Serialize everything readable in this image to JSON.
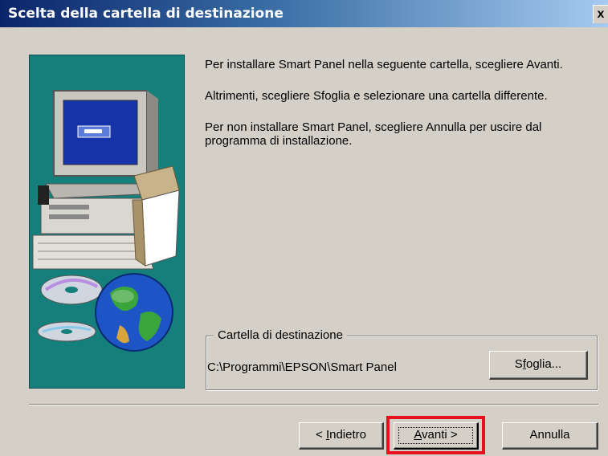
{
  "window": {
    "title": "Scelta della cartella di destinazione",
    "close_label": "x"
  },
  "instructions": {
    "para1": "Per installare Smart Panel nella seguente cartella, scegliere Avanti.",
    "para2": "Altrimenti, scegliere Sfoglia e selezionare una cartella differente.",
    "para3": "Per non installare Smart Panel, scegliere Annulla per uscire dal programma di installazione."
  },
  "destination": {
    "legend": "Cartella di destinazione",
    "path": "C:\\Programmi\\EPSON\\Smart Panel",
    "browse_pre": "S",
    "browse_accel": "f",
    "browse_post": "oglia..."
  },
  "footer": {
    "back_pre": "< ",
    "back_accel": "I",
    "back_post": "ndietro",
    "next_accel": "A",
    "next_post": "vanti >",
    "cancel_label": "Annulla"
  },
  "icons": {
    "illustration": "computer-globe-cd-illustration",
    "close": "close-icon"
  },
  "colors": {
    "side_panel": "#147f7b",
    "highlight": "#e8101f",
    "titlebar_start": "#0a246a"
  }
}
